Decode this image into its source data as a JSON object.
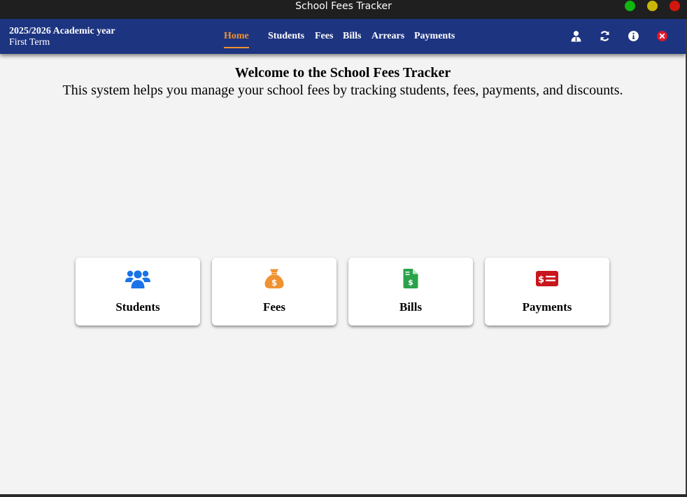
{
  "window": {
    "title": "School Fees Tracker",
    "controls": {
      "minimize_color": "#11b611",
      "maximize_color": "#c9b608",
      "close_color": "#d3160e"
    }
  },
  "header": {
    "academic_year": "2025/2026 Academic year",
    "term": "First Term",
    "background": "#1d3480"
  },
  "nav": {
    "active_color": "#f0922f",
    "items": [
      {
        "label": "Home",
        "active": true
      },
      {
        "label": "Students",
        "active": false
      },
      {
        "label": "Fees",
        "active": false
      },
      {
        "label": "Bills",
        "active": false
      },
      {
        "label": "Arrears",
        "active": false
      },
      {
        "label": "Payments",
        "active": false
      }
    ],
    "icons": [
      "user-icon",
      "refresh-icon",
      "info-icon",
      "close-circle-icon"
    ]
  },
  "main": {
    "heading": "Welcome to the School Fees Tracker",
    "description": "This system helps you manage your school fees by tracking students, fees, payments, and discounts.",
    "cards": [
      {
        "label": "Students",
        "icon": "users-icon",
        "color": "#1a73e8"
      },
      {
        "label": "Fees",
        "icon": "money-bag-icon",
        "color": "#f0922f"
      },
      {
        "label": "Bills",
        "icon": "bill-document-icon",
        "color": "#2aa34a"
      },
      {
        "label": "Payments",
        "icon": "money-bill-icon",
        "color": "#c8161d"
      }
    ]
  }
}
